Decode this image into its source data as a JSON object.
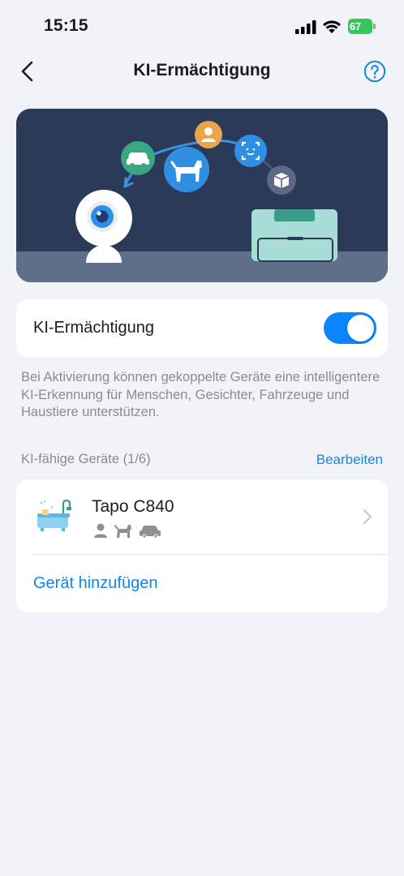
{
  "status_bar": {
    "time": "15:15",
    "battery": "67"
  },
  "nav": {
    "title": "KI-Ermächtigung"
  },
  "toggle": {
    "label": "KI-Ermächtigung",
    "state": "on"
  },
  "description": "Bei Aktivierung können gekoppelte Geräte eine intelligentere KI-Erkennung für Menschen, Gesichter, Fahrzeuge und Haustiere unterstützen.",
  "section": {
    "title": "KI-fähige Geräte (1/6)",
    "edit": "Bearbeiten"
  },
  "devices": [
    {
      "name": "Tapo C840",
      "features": [
        "person-icon",
        "pet-icon",
        "vehicle-icon"
      ]
    }
  ],
  "add_device": "Gerät hinzufügen",
  "colors": {
    "accent": "#1586e0",
    "toggle_on": "#0a84ff",
    "battery": "#34c759",
    "hero_bg": "#2a3a58"
  }
}
